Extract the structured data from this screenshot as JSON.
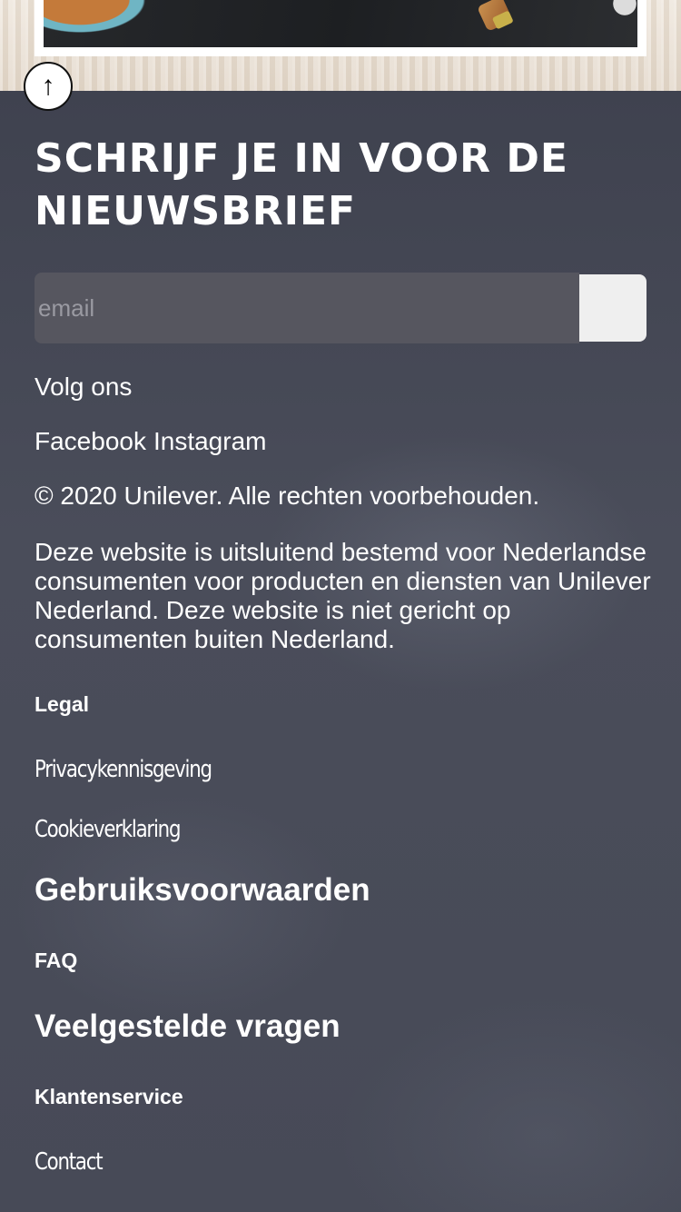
{
  "newsletter": {
    "heading": "SCHRIJF JE IN VOOR DE NIEUWSBRIEF",
    "email_placeholder": "email",
    "submit_label": ""
  },
  "scroll_top_glyph": "↑",
  "social": {
    "title": "Volg ons",
    "links": [
      "Facebook",
      "Instagram"
    ]
  },
  "copyright": "© 2020 Unilever. Alle rechten voorbehouden.",
  "disclaimer": "Deze website is uitsluitend bestemd voor Nederlandse consumenten voor producten en diensten van Unilever Nederland. Deze website is niet gericht op consumenten buiten Nederland.",
  "legal": {
    "title": "Legal",
    "links": [
      "Privacykennisgeving",
      "Cookieverklaring",
      "Gebruiksvoorwaarden"
    ]
  },
  "faq": {
    "title": "FAQ",
    "links": [
      "Veelgestelde vragen"
    ]
  },
  "customer_service": {
    "title": "Klantenservice",
    "links": [
      "Contact"
    ]
  },
  "colors": {
    "footer_bg": "#44475a",
    "text": "#ffffff",
    "input_bg": "#56565f",
    "button_bg": "#efefef"
  }
}
